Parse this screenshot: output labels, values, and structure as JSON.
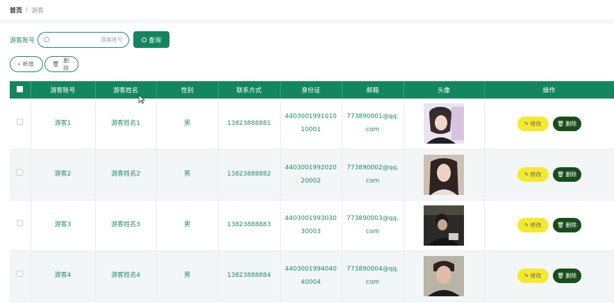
{
  "breadcrumb": {
    "home": "首页",
    "separator": "/",
    "current": "游客"
  },
  "search": {
    "label": "游客账号",
    "placeholder": "游客账号",
    "button": "查询"
  },
  "actions": {
    "add": "新增",
    "delete": "删除"
  },
  "table": {
    "headers": [
      "游客账号",
      "游客姓名",
      "性别",
      "联系方式",
      "身份证",
      "邮箱",
      "头像",
      "操作"
    ],
    "rows": [
      {
        "account": "游客1",
        "name": "游客姓名1",
        "gender": "男",
        "phone": "13823888881",
        "id_card": "440300199101010001",
        "email": "773890001@qq.com"
      },
      {
        "account": "游客2",
        "name": "游客姓名2",
        "gender": "男",
        "phone": "13823888882",
        "id_card": "440300199202020002",
        "email": "773890002@qq.com"
      },
      {
        "account": "游客3",
        "name": "游客姓名3",
        "gender": "男",
        "phone": "13823888883",
        "id_card": "440300199303030003",
        "email": "773890003@qq.com"
      },
      {
        "account": "游客4",
        "name": "游客姓名4",
        "gender": "男",
        "phone": "13823888884",
        "id_card": "440300199404040004",
        "email": "773890004@qq.com"
      }
    ],
    "edit_label": "修改",
    "delete_label": "删除"
  },
  "colors": {
    "primary": "#13865f",
    "edit": "#f5e92e",
    "delete": "#1a4d1c"
  }
}
